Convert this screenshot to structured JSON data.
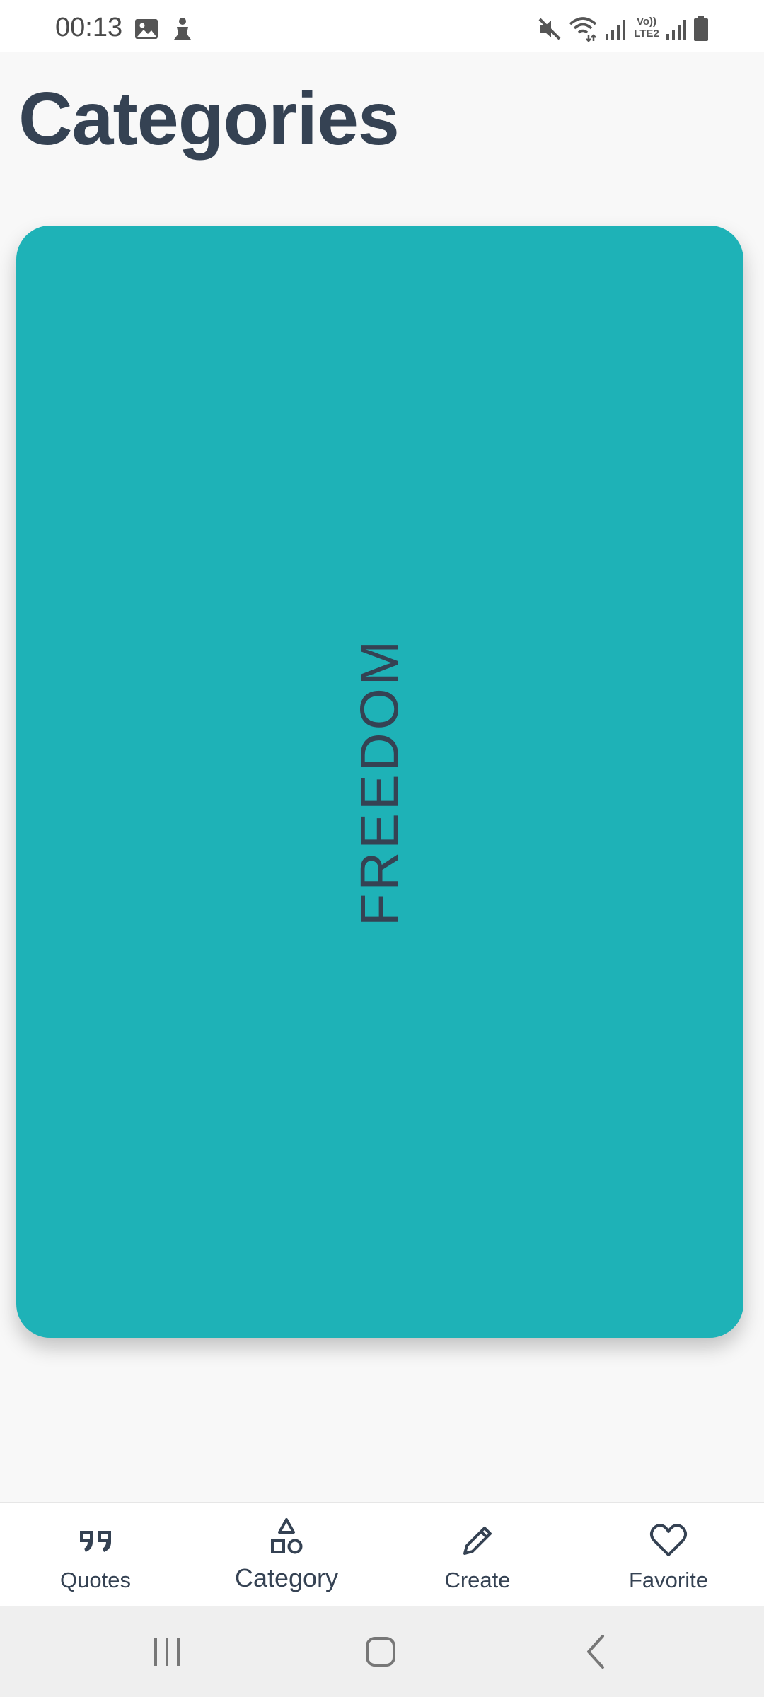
{
  "status_bar": {
    "time": "00:13",
    "icons": [
      "image-icon",
      "person-icon",
      "mute-icon",
      "wifi-icon",
      "signal-icon",
      "volte-lte2-icon",
      "signal-icon",
      "battery-icon"
    ],
    "volte_text": "Vo))",
    "lte_text": "LTE2"
  },
  "page": {
    "title": "Categories"
  },
  "categories": [
    {
      "label": "FREEDOM",
      "color": "#1eb2b7"
    }
  ],
  "bottom_nav": {
    "items": [
      {
        "label": "Quotes",
        "icon": "quote-icon",
        "active": false
      },
      {
        "label": "Category",
        "icon": "shapes-icon",
        "active": true
      },
      {
        "label": "Create",
        "icon": "pencil-icon",
        "active": false
      },
      {
        "label": "Favorite",
        "icon": "heart-icon",
        "active": false
      }
    ]
  },
  "system_nav": {
    "buttons": [
      "recents-icon",
      "home-icon",
      "back-icon"
    ]
  },
  "colors": {
    "text_primary": "#354253",
    "card_teal": "#1eb2b7",
    "background": "#f8f8f8"
  }
}
